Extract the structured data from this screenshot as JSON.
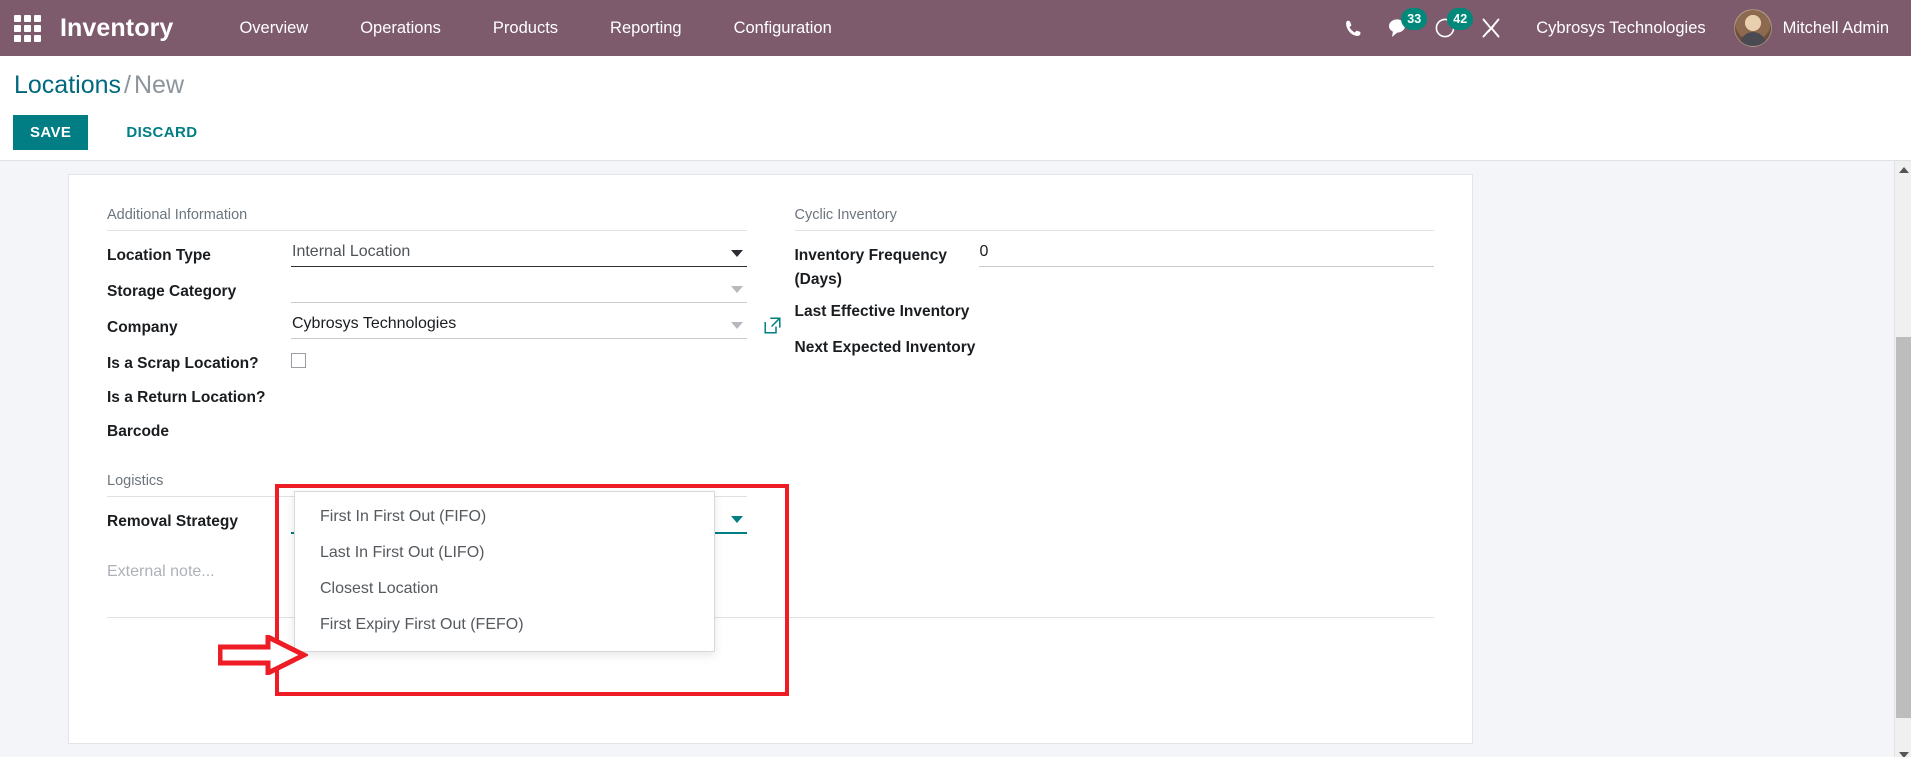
{
  "navbar": {
    "apps_icon": "apps-grid-icon",
    "brand": "Inventory",
    "menu": [
      {
        "label": "Overview"
      },
      {
        "label": "Operations"
      },
      {
        "label": "Products"
      },
      {
        "label": "Reporting"
      },
      {
        "label": "Configuration"
      }
    ],
    "sys_icons": [
      {
        "name": "phone-icon",
        "badge": ""
      },
      {
        "name": "messages-icon",
        "badge": "33"
      },
      {
        "name": "activities-clock-icon",
        "badge": "42"
      },
      {
        "name": "debug-tools-icon",
        "badge": ""
      }
    ],
    "messages_count": "33",
    "activities_count": "42",
    "company": "Cybrosys Technologies",
    "user": "Mitchell Admin",
    "brand_color": "#7D5A6C",
    "badge_color": "#00897B"
  },
  "control_panel": {
    "breadcrumb_root": "Locations",
    "breadcrumb_sep": "/",
    "breadcrumb_current": "New",
    "save_label": "SAVE",
    "discard_label": "DISCARD",
    "save_color": "#017E84"
  },
  "form": {
    "left": {
      "group_title": "Additional Information",
      "fields": [
        {
          "label": "Location Type",
          "value": "Internal Location",
          "type": "select"
        },
        {
          "label": "Storage Category",
          "value": "",
          "type": "select-muted"
        },
        {
          "label": "Company",
          "value": "Cybrosys Technologies",
          "type": "many2one"
        },
        {
          "label": "Is a Scrap Location?",
          "value": "",
          "type": "checkbox"
        },
        {
          "label": "Is a Return Location?",
          "value": "",
          "type": "checkbox"
        },
        {
          "label": "Barcode",
          "value": "",
          "type": "text"
        }
      ],
      "logistics_title": "Logistics",
      "removal_strategy_label": "Removal Strategy",
      "removal_strategy_value": "",
      "note_placeholder": "External note..."
    },
    "right": {
      "group_title": "Cyclic Inventory",
      "fields": [
        {
          "label": "Inventory Frequency (Days)",
          "value": "0",
          "type": "number"
        },
        {
          "label": "Last Effective Inventory",
          "value": "",
          "type": "date"
        },
        {
          "label": "Next Expected Inventory",
          "value": "",
          "type": "date"
        }
      ]
    }
  },
  "dropdown": {
    "open": true,
    "options": [
      {
        "label": "First In First Out (FIFO)"
      },
      {
        "label": "Last In First Out (LIFO)"
      },
      {
        "label": "Closest Location"
      },
      {
        "label": "First Expiry First Out (FEFO)"
      }
    ]
  },
  "annotations": {
    "highlight_color": "#EE1C25",
    "box_target": "removal-strategy-dropdown",
    "arrow_target": "removal-strategy-field"
  }
}
